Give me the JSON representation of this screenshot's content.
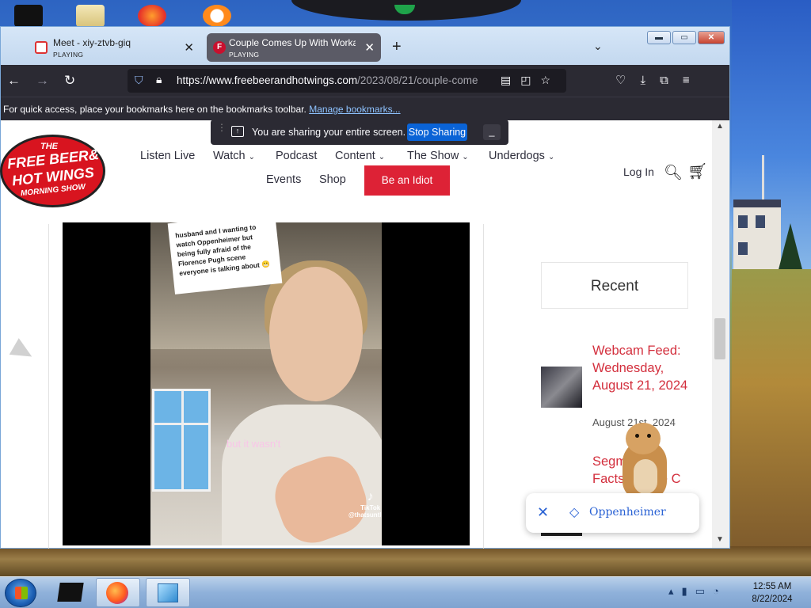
{
  "tabs": [
    {
      "title": "Meet - xiy-ztvb-giq",
      "status": "PLAYING"
    },
    {
      "title": "Couple Comes Up With Workar",
      "status": "PLAYING"
    }
  ],
  "url": {
    "main": "https://www.freebeerandhotwings.com",
    "path": "/2023/08/21/couple-come"
  },
  "bookmarks": {
    "message": "For quick access, place your bookmarks here on the bookmarks toolbar.",
    "link": "Manage bookmarks..."
  },
  "sharing": {
    "message": "You are sharing your entire screen.",
    "stop_label": "Stop Sharing",
    "minimize_label": "_"
  },
  "logo": {
    "line1": "THE",
    "line2": "FREE BEER&",
    "line3": "HOT WINGS",
    "line4": "MORNING SHOW"
  },
  "site_nav": {
    "row1": [
      "Listen Live",
      "Watch",
      "Podcast",
      "Content",
      "The Show",
      "Underdogs"
    ],
    "row2": [
      "Events",
      "Shop"
    ],
    "cta": "Be an Idiot",
    "login": "Log In"
  },
  "video": {
    "caption": "husband and I wanting to watch Oppenheimer but being fully afraid of the Florence Pugh scene everyone is talking about 😬",
    "subtitle": "but it wasn't",
    "tiktok_label": "TikTok",
    "tiktok_handle": "@thatsuntlove"
  },
  "sidebar": {
    "heading": "Recent",
    "posts": [
      {
        "title": "Webcam Feed: Wednesday, August 21, 2024",
        "date": "August 21st, 2024"
      },
      {
        "title": "Segm Mens Facts Of The C"
      }
    ]
  },
  "chip": {
    "label": "Oppenheimer"
  },
  "clock": {
    "time": "12:55 AM",
    "date": "8/22/2024"
  },
  "colors": {
    "accent": "#dd2236",
    "link_red": "#d32f3d",
    "firefox_dark": "#2b2a33",
    "share_blue": "#0a63d6"
  }
}
